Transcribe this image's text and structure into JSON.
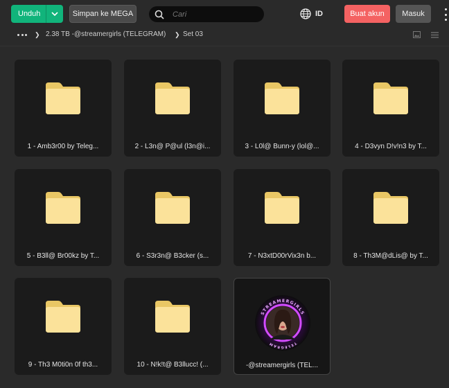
{
  "toolbar": {
    "download_label": "Unduh",
    "save_to_mega_label": "Simpan ke MEGA",
    "search_placeholder": "Cari",
    "language_code": "ID",
    "create_account_label": "Buat akun",
    "login_label": "Masuk"
  },
  "breadcrumb": {
    "items": [
      "2.38 TB -@streamergirls (TELEGRAM)",
      "Set 03"
    ]
  },
  "colors": {
    "download_button": "#11b47b",
    "create_account_button": "#f46262",
    "folder": "#fbe29a"
  },
  "items": [
    {
      "name": "1 - Amb3r00 by Teleg...",
      "type": "folder"
    },
    {
      "name": "2 - L3n@ P@ul (l3n@i...",
      "type": "folder"
    },
    {
      "name": "3 - L0l@ Bunn-y (lol@...",
      "type": "folder"
    },
    {
      "name": "4 - D3vyn D!v!n3 by T...",
      "type": "folder"
    },
    {
      "name": "5 - B3ll@ Br00kz by T...",
      "type": "folder"
    },
    {
      "name": "6 - S3r3n@ B3cker (s...",
      "type": "folder"
    },
    {
      "name": "7 - N3xtD00rVix3n b...",
      "type": "folder"
    },
    {
      "name": "8 - Th3M@dLis@ by T...",
      "type": "folder"
    },
    {
      "name": "9 - Th3 M0ti0n 0f th3...",
      "type": "folder"
    },
    {
      "name": "10 - N!k!t@ B3llucc! (...",
      "type": "folder"
    },
    {
      "name": "-@streamergirls (TEL...",
      "type": "image",
      "logo_text_top": "STREAMERGIRLS",
      "logo_text_bottom": "TELEGRAM"
    }
  ]
}
